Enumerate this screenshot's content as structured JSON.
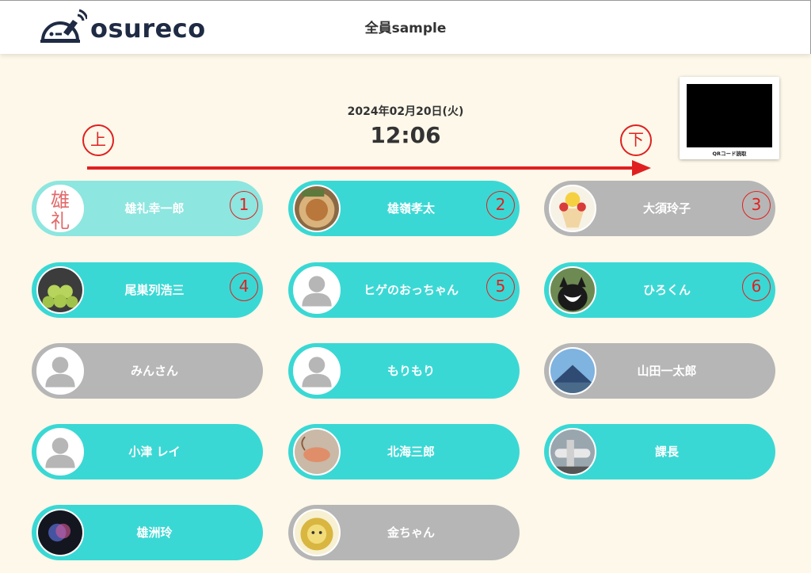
{
  "app": {
    "logo_text": "osureco",
    "title": "全員sample"
  },
  "qr": {
    "label": "QRコード読取"
  },
  "clock": {
    "date": "2024年02月20日(火)",
    "time": "12:06"
  },
  "direction": {
    "start": "上",
    "end": "下"
  },
  "members": [
    {
      "name": "雄礼幸一郎",
      "state": "light",
      "order": "1",
      "avatar": "kanji-icon"
    },
    {
      "name": "雄嶺孝太",
      "state": "teal",
      "order": "2",
      "avatar": "food-photo"
    },
    {
      "name": "大須玲子",
      "state": "gray",
      "order": "3",
      "avatar": "parfait-photo"
    },
    {
      "name": "尾巣列浩三",
      "state": "teal",
      "order": "4",
      "avatar": "grapes-photo"
    },
    {
      "name": "ヒゲのおっちゃん",
      "state": "teal",
      "order": "5",
      "avatar": "default-user-icon"
    },
    {
      "name": "ひろくん",
      "state": "teal",
      "order": "6",
      "avatar": "cat-photo"
    },
    {
      "name": "みんさん",
      "state": "gray",
      "order": "",
      "avatar": "default-user-icon"
    },
    {
      "name": "もりもり",
      "state": "teal",
      "order": "",
      "avatar": "default-user-icon"
    },
    {
      "name": "山田一太郎",
      "state": "gray",
      "order": "",
      "avatar": "mountain-photo"
    },
    {
      "name": "小津 レイ",
      "state": "teal",
      "order": "",
      "avatar": "default-user-icon"
    },
    {
      "name": "北海三郎",
      "state": "teal",
      "order": "",
      "avatar": "shrimp-photo"
    },
    {
      "name": "課長",
      "state": "teal",
      "order": "",
      "avatar": "airplane-photo"
    },
    {
      "name": "雄洲玲",
      "state": "teal",
      "order": "",
      "avatar": "dark-abstract-photo"
    },
    {
      "name": "金ちゃん",
      "state": "gray",
      "order": "",
      "avatar": "lion-icon"
    }
  ],
  "colors": {
    "teal": "#3ad8d4",
    "light": "#8de6df",
    "gray": "#b6b6b6",
    "accent_red": "#e02020",
    "background": "#fdf8ea"
  }
}
